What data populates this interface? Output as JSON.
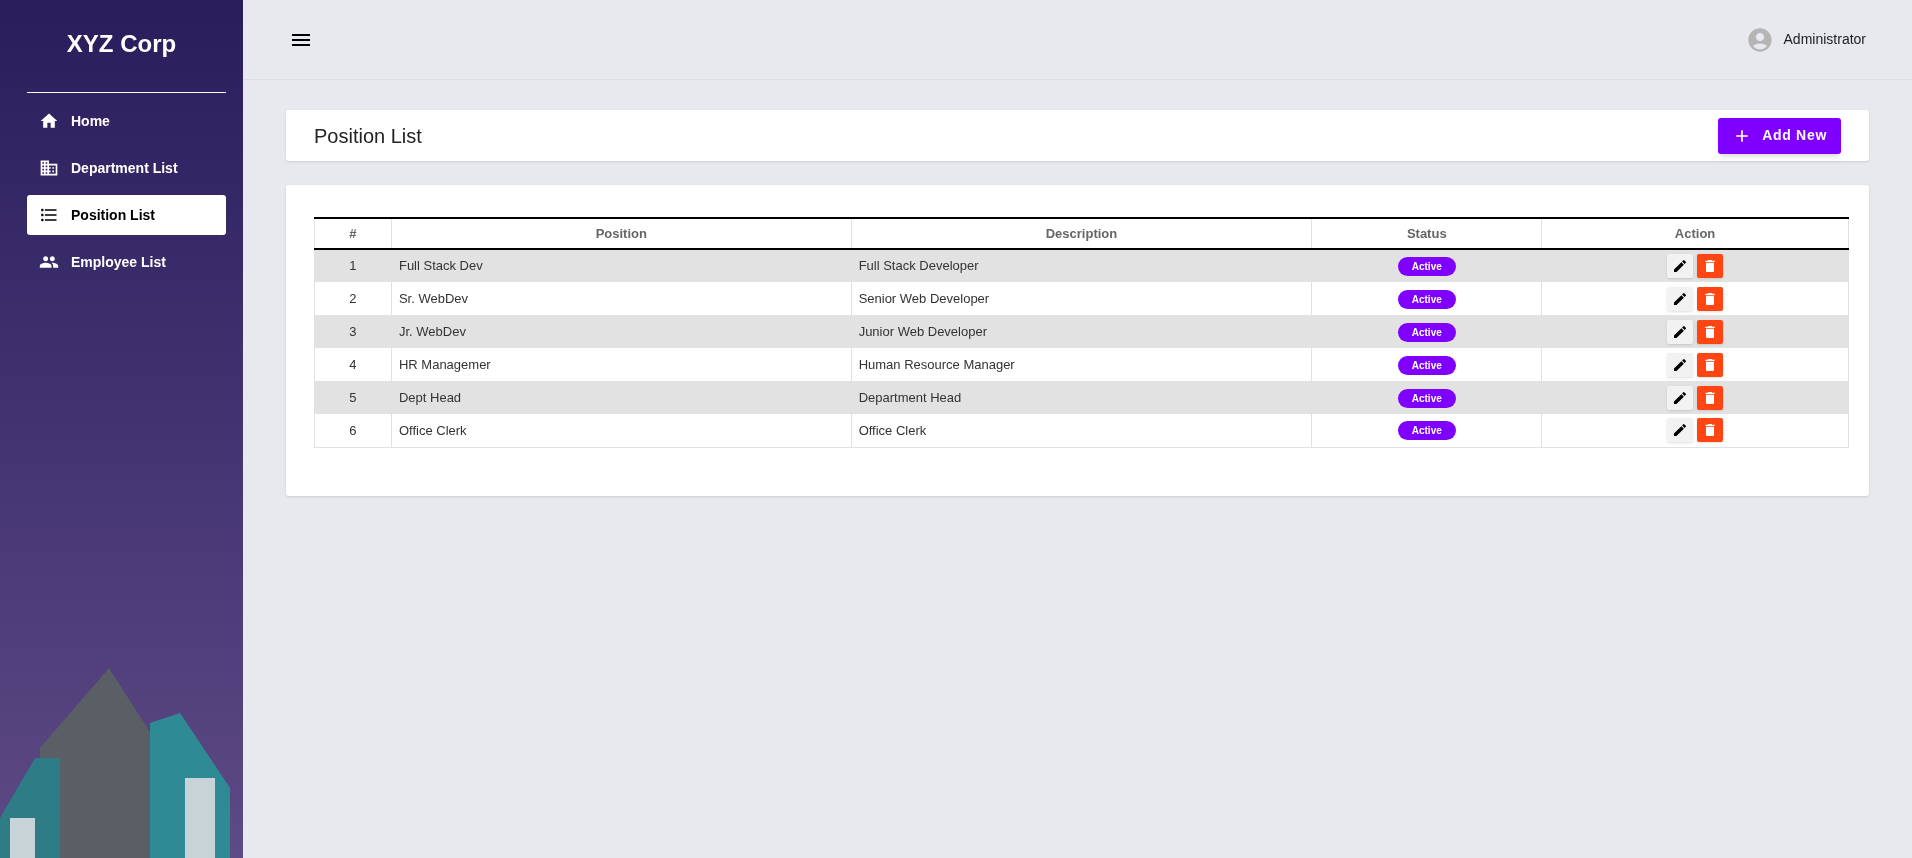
{
  "sidebar": {
    "brand": "XYZ Corp",
    "items": [
      {
        "label": "Home",
        "selected": false
      },
      {
        "label": "Department List",
        "selected": false
      },
      {
        "label": "Position List",
        "selected": true
      },
      {
        "label": "Employee List",
        "selected": false
      }
    ]
  },
  "topbar": {
    "user": "Administrator"
  },
  "page": {
    "title": "Position List",
    "add_button": "Add New"
  },
  "table": {
    "columns": [
      "#",
      "Position",
      "Description",
      "Status",
      "Action"
    ],
    "rows": [
      {
        "index": "1",
        "position": "Full Stack Dev",
        "description": "Full Stack Developer",
        "status": "Active"
      },
      {
        "index": "2",
        "position": "Sr. WebDev",
        "description": "Senior Web Developer",
        "status": "Active"
      },
      {
        "index": "3",
        "position": "Jr. WebDev",
        "description": "Junior Web Developer",
        "status": "Active"
      },
      {
        "index": "4",
        "position": "HR Managemer",
        "description": "Human Resource Manager",
        "status": "Active"
      },
      {
        "index": "5",
        "position": "Dept Head",
        "description": "Department Head",
        "status": "Active"
      },
      {
        "index": "6",
        "position": "Office Clerk",
        "description": "Office Clerk",
        "status": "Active"
      }
    ]
  }
}
